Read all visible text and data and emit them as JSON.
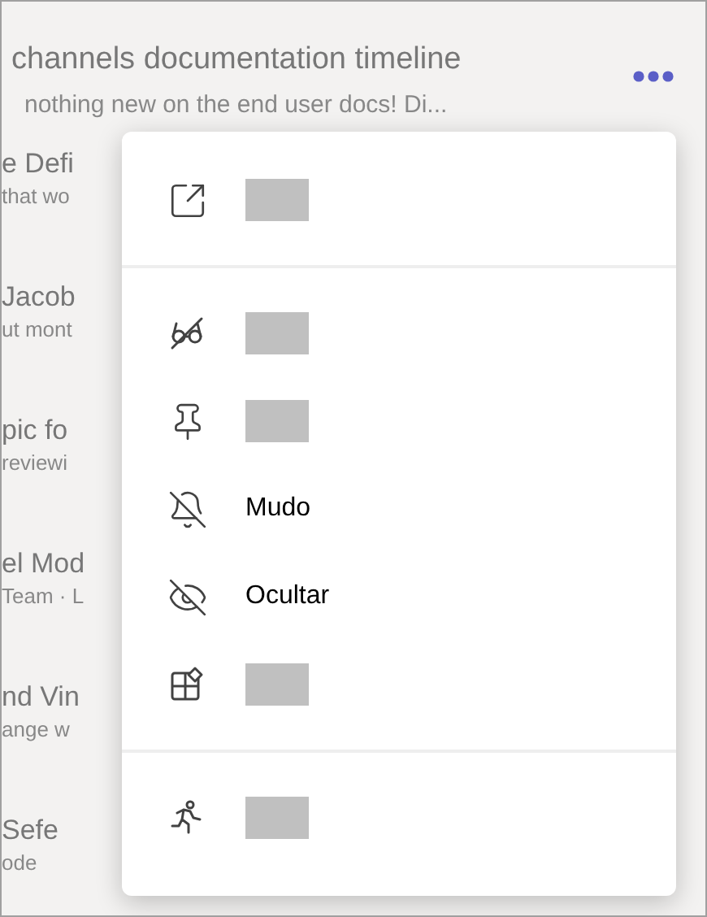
{
  "background": {
    "title": "channels documentation timeline",
    "subtitle": "nothing new on the end user docs! Di...",
    "rows": [
      {
        "title": "e Defi",
        "subtitle": "that wo"
      },
      {
        "title": "Jacob",
        "subtitle": "ut mont"
      },
      {
        "title": "pic fo",
        "subtitle": "reviewi"
      },
      {
        "title": "el Mod",
        "subtitle": "Team · L"
      },
      {
        "title": "nd Vin",
        "subtitle": "ange w"
      },
      {
        "title": "Sefe",
        "subtitle": "ode"
      }
    ]
  },
  "menu": {
    "groups": [
      [
        {
          "kind": "redacted"
        }
      ],
      [
        {
          "kind": "redacted"
        },
        {
          "kind": "redacted"
        },
        {
          "kind": "text",
          "label": "Mudo"
        },
        {
          "kind": "text",
          "label": "Ocultar"
        },
        {
          "kind": "redacted"
        }
      ],
      [
        {
          "kind": "redacted"
        }
      ]
    ]
  }
}
